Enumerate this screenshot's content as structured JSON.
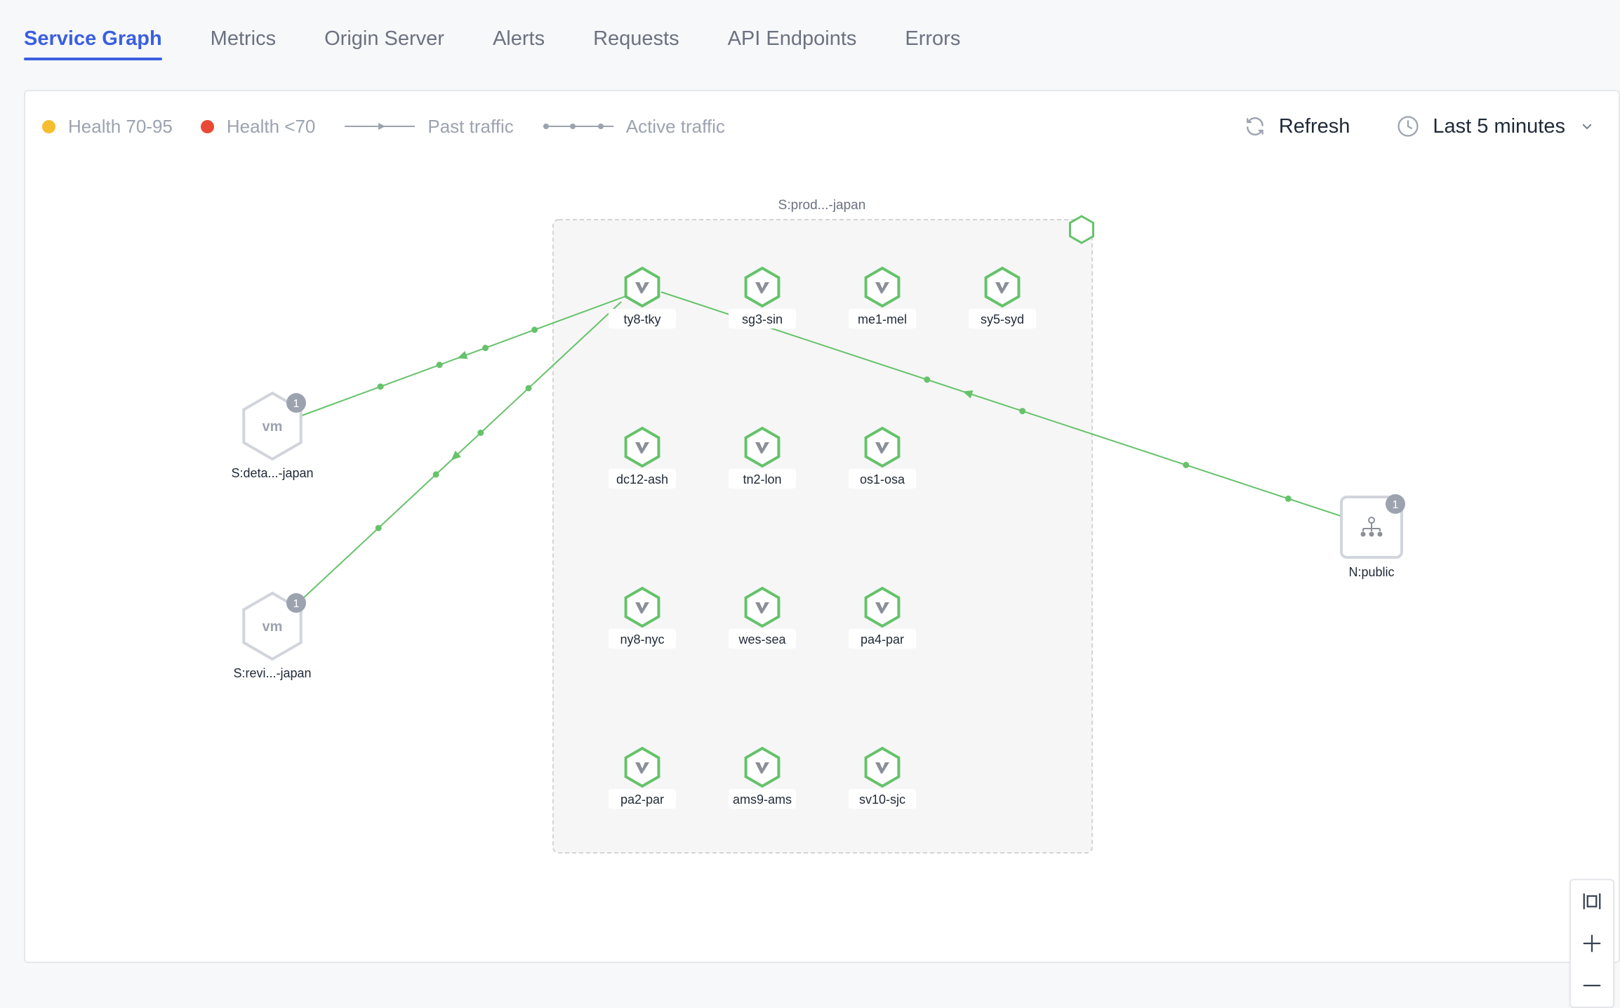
{
  "tabs": [
    {
      "label": "Service Graph",
      "active": true
    },
    {
      "label": "Metrics",
      "active": false
    },
    {
      "label": "Origin Server",
      "active": false
    },
    {
      "label": "Alerts",
      "active": false
    },
    {
      "label": "Requests",
      "active": false
    },
    {
      "label": "API Endpoints",
      "active": false
    },
    {
      "label": "Errors",
      "active": false
    }
  ],
  "legend": {
    "health_warn_label": "Health 70-95",
    "health_warn_color": "#f6bd2e",
    "health_bad_label": "Health <70",
    "health_bad_color": "#e84a36",
    "past_traffic_label": "Past traffic",
    "active_traffic_label": "Active traffic"
  },
  "toolbar": {
    "refresh_label": "Refresh",
    "time_range_label": "Last 5 minutes"
  },
  "graph": {
    "accent_color": "#66c26b",
    "group_label": "S:prod...-japan",
    "site_icon": "v-logo-icon",
    "sites": [
      "ty8-tky",
      "sg3-sin",
      "me1-mel",
      "sy5-syd",
      "dc12-ash",
      "tn2-lon",
      "os1-osa",
      "ny8-nyc",
      "wes-sea",
      "pa4-par",
      "pa2-par",
      "ams9-ams",
      "sv10-sjc"
    ],
    "vm_nodes": [
      {
        "label": "S:deta...-japan",
        "icon_text": "vm",
        "badge": "1"
      },
      {
        "label": "S:revi...-japan",
        "icon_text": "vm",
        "badge": "1"
      }
    ],
    "network_node": {
      "label": "N:public",
      "badge": "1",
      "icon": "network-hierarchy-icon"
    }
  }
}
